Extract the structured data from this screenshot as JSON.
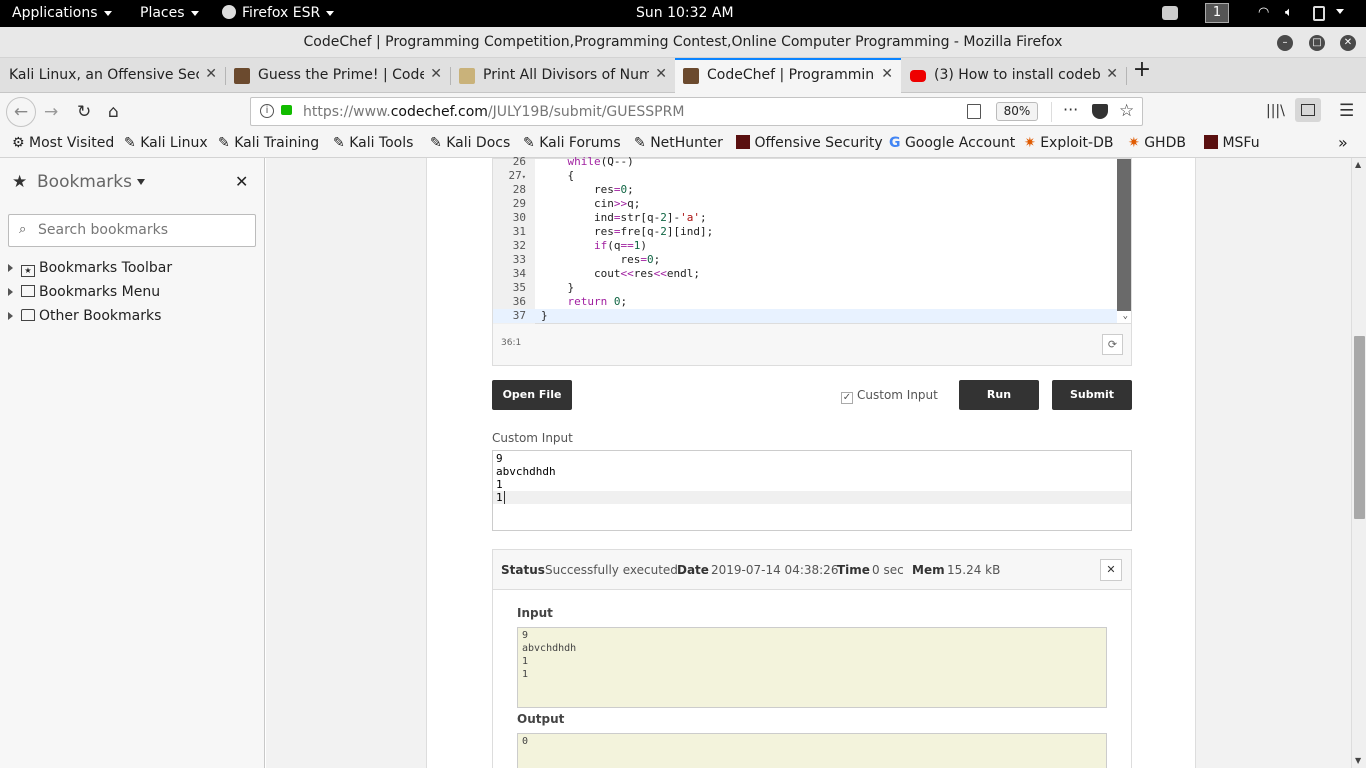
{
  "system": {
    "applications": "Applications",
    "places": "Places",
    "browser_menu": "Firefox ESR",
    "clock": "Sun 10:32 AM",
    "workspace": "1"
  },
  "window": {
    "title": "CodeChef | Programming Competition,Programming Contest,Online Computer Programming - Mozilla Firefox"
  },
  "tabs": [
    {
      "label": "Kali Linux, an Offensive Secu"
    },
    {
      "label": "Guess the Prime! | CodeC"
    },
    {
      "label": "Print All Divisors of Numb"
    },
    {
      "label": "CodeChef | Programming"
    },
    {
      "label": "(3) How to install codeblo"
    }
  ],
  "nav": {
    "url_prefix": "https://www.",
    "url_domain": "codechef.com",
    "url_path": "/JULY19B/submit/GUESSPRM",
    "zoom": "80%"
  },
  "bookmarks_bar": [
    "Most Visited",
    "Kali Linux",
    "Kali Training",
    "Kali Tools",
    "Kali Docs",
    "Kali Forums",
    "NetHunter",
    "Offensive Security",
    "Google Account",
    "Exploit-DB",
    "GHDB",
    "MSFu"
  ],
  "sidebar": {
    "title": "Bookmarks",
    "search_placeholder": "Search bookmarks",
    "items": [
      "Bookmarks Toolbar",
      "Bookmarks Menu",
      "Other Bookmarks"
    ]
  },
  "editor": {
    "lines": [
      {
        "n": "26",
        "text": "    while(Q--)"
      },
      {
        "n": "27",
        "text": "    {"
      },
      {
        "n": "28",
        "text": "        res=0;"
      },
      {
        "n": "29",
        "text": "        cin>>q;"
      },
      {
        "n": "30",
        "text": "        ind=str[q-2]-'a';"
      },
      {
        "n": "31",
        "text": "        res=fre[q-2][ind];"
      },
      {
        "n": "32",
        "text": "        if(q==1)"
      },
      {
        "n": "33",
        "text": "            res=0;"
      },
      {
        "n": "34",
        "text": "        cout<<res<<endl;"
      },
      {
        "n": "35",
        "text": "    }"
      },
      {
        "n": "36",
        "text": "    return 0;"
      },
      {
        "n": "37",
        "text": "}"
      }
    ],
    "cursor_pos": "36:1"
  },
  "actions": {
    "open_file": "Open File",
    "custom_input_label": "Custom Input",
    "run": "Run",
    "submit": "Submit"
  },
  "custom_input": {
    "label": "Custom Input",
    "lines": [
      "9",
      "abvchdhdh",
      "1",
      "1"
    ]
  },
  "result": {
    "status_label": "Status",
    "status_value": "Successfully executed",
    "date_label": "Date",
    "date_value": "2019-07-14 04:38:26",
    "time_label": "Time",
    "time_value": "0 sec",
    "mem_label": "Mem",
    "mem_value": "15.24 kB",
    "input_label": "Input",
    "input_lines": [
      "9",
      "abvchdhdh",
      "1",
      "1"
    ],
    "output_label": "Output",
    "output_lines": [
      "0"
    ]
  }
}
